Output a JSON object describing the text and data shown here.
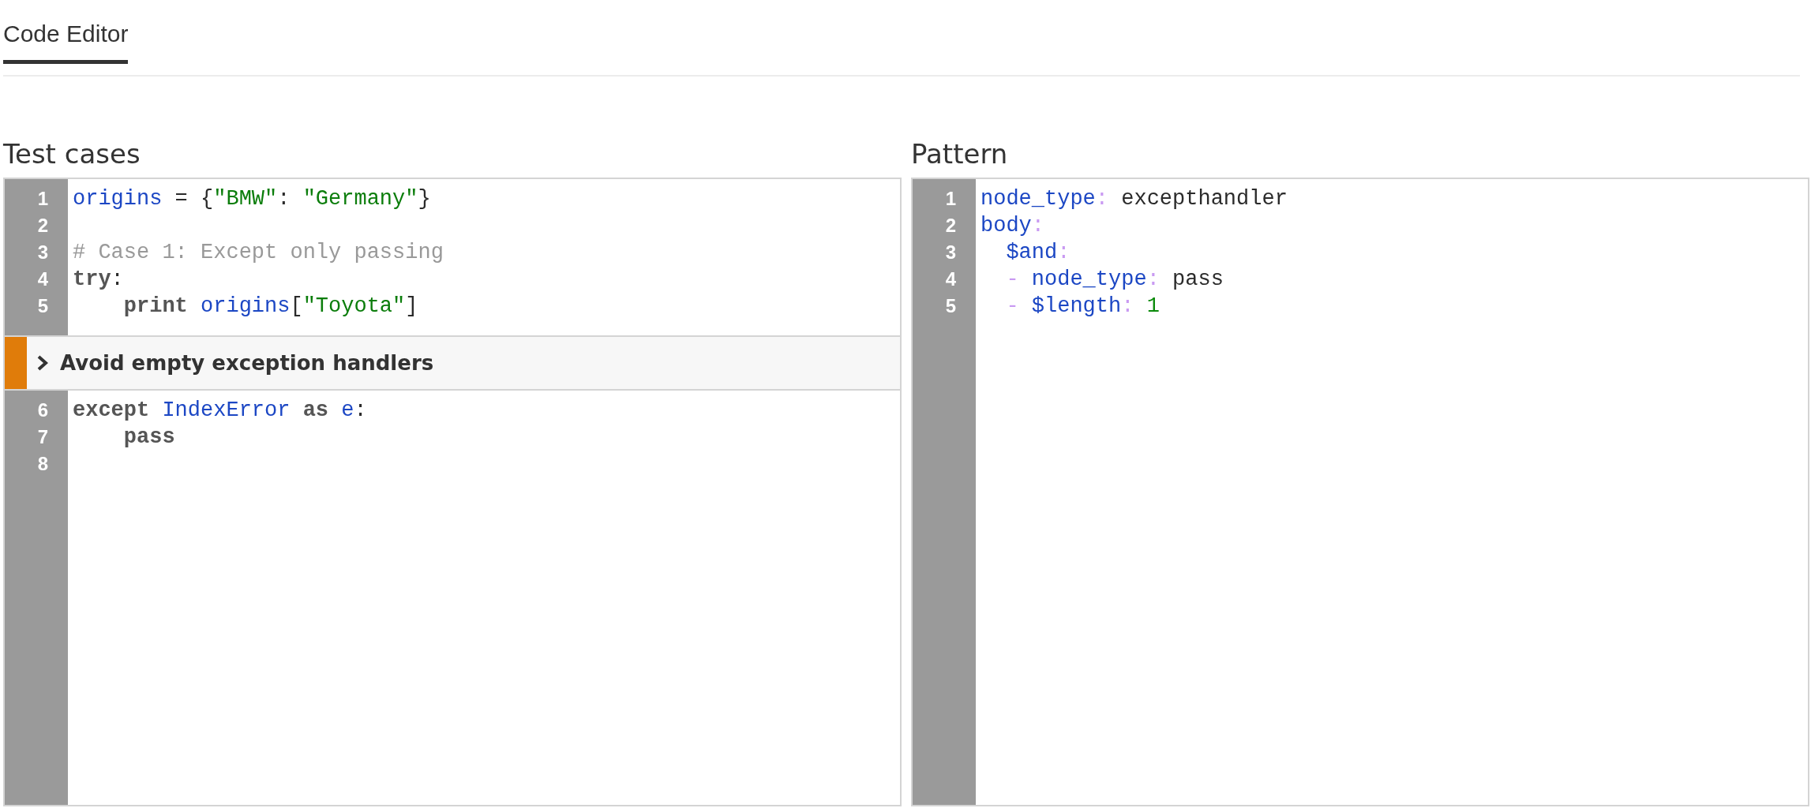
{
  "tabs": [
    {
      "label": "Code Editor",
      "selected": true
    }
  ],
  "panels": [
    {
      "title": "Test cases",
      "blocks": [
        {
          "kind": "code",
          "lines": [
            {
              "number": "1",
              "tokens": [
                {
                  "kind": "name",
                  "text": "origins"
                },
                {
                  "kind": "plain",
                  "text": " = {"
                },
                {
                  "kind": "string",
                  "text": "\"BMW\""
                },
                {
                  "kind": "plain",
                  "text": ": "
                },
                {
                  "kind": "string",
                  "text": "\"Germany\""
                },
                {
                  "kind": "plain",
                  "text": "}"
                }
              ]
            },
            {
              "number": "2"
            },
            {
              "number": "3",
              "tokens": [
                {
                  "kind": "comment",
                  "text": "# Case 1: Except only passing"
                }
              ]
            },
            {
              "number": "4",
              "tokens": [
                {
                  "kind": "keyword",
                  "text": "try"
                },
                {
                  "kind": "plain",
                  "text": ":"
                }
              ]
            },
            {
              "number": "5",
              "tokens": [
                {
                  "kind": "keyword",
                  "text": "    print"
                },
                {
                  "kind": "name",
                  "text": " origins"
                },
                {
                  "kind": "plain",
                  "text": "["
                },
                {
                  "kind": "string",
                  "text": "\"Toyota\""
                },
                {
                  "kind": "plain",
                  "text": "]"
                }
              ]
            }
          ]
        },
        {
          "kind": "annotation",
          "message": "Avoid empty exception handlers",
          "expanded": false
        },
        {
          "kind": "code",
          "lines": [
            {
              "number": "6",
              "tokens": [
                {
                  "kind": "keyword",
                  "text": "except"
                },
                {
                  "kind": "name",
                  "text": " IndexError"
                },
                {
                  "kind": "keyword",
                  "text": " as"
                },
                {
                  "kind": "name",
                  "text": " e"
                },
                {
                  "kind": "plain",
                  "text": ":"
                }
              ]
            },
            {
              "number": "7",
              "tokens": [
                {
                  "kind": "keyword",
                  "text": "    pass"
                }
              ]
            },
            {
              "number": "8"
            }
          ]
        }
      ]
    },
    {
      "title": "Pattern",
      "blocks": [
        {
          "kind": "code",
          "lines": [
            {
              "number": "1",
              "tokens": [
                {
                  "kind": "name",
                  "text": "node_type"
                },
                {
                  "kind": "punct",
                  "text": ":"
                },
                {
                  "kind": "plain",
                  "text": " excepthandler"
                }
              ]
            },
            {
              "number": "2",
              "tokens": [
                {
                  "kind": "name",
                  "text": "body"
                },
                {
                  "kind": "punct",
                  "text": ":"
                }
              ]
            },
            {
              "number": "3",
              "tokens": [
                {
                  "kind": "name",
                  "text": "  $and"
                },
                {
                  "kind": "punct",
                  "text": ":"
                }
              ]
            },
            {
              "number": "4",
              "tokens": [
                {
                  "kind": "punct",
                  "text": "  -"
                },
                {
                  "kind": "name",
                  "text": " node_type"
                },
                {
                  "kind": "punct",
                  "text": ":"
                },
                {
                  "kind": "plain",
                  "text": " pass"
                }
              ]
            },
            {
              "number": "5",
              "tokens": [
                {
                  "kind": "punct",
                  "text": "  -"
                },
                {
                  "kind": "name",
                  "text": " $length"
                },
                {
                  "kind": "punct",
                  "text": ":"
                },
                {
                  "kind": "number",
                  "text": " 1"
                }
              ]
            }
          ]
        }
      ]
    }
  ]
}
